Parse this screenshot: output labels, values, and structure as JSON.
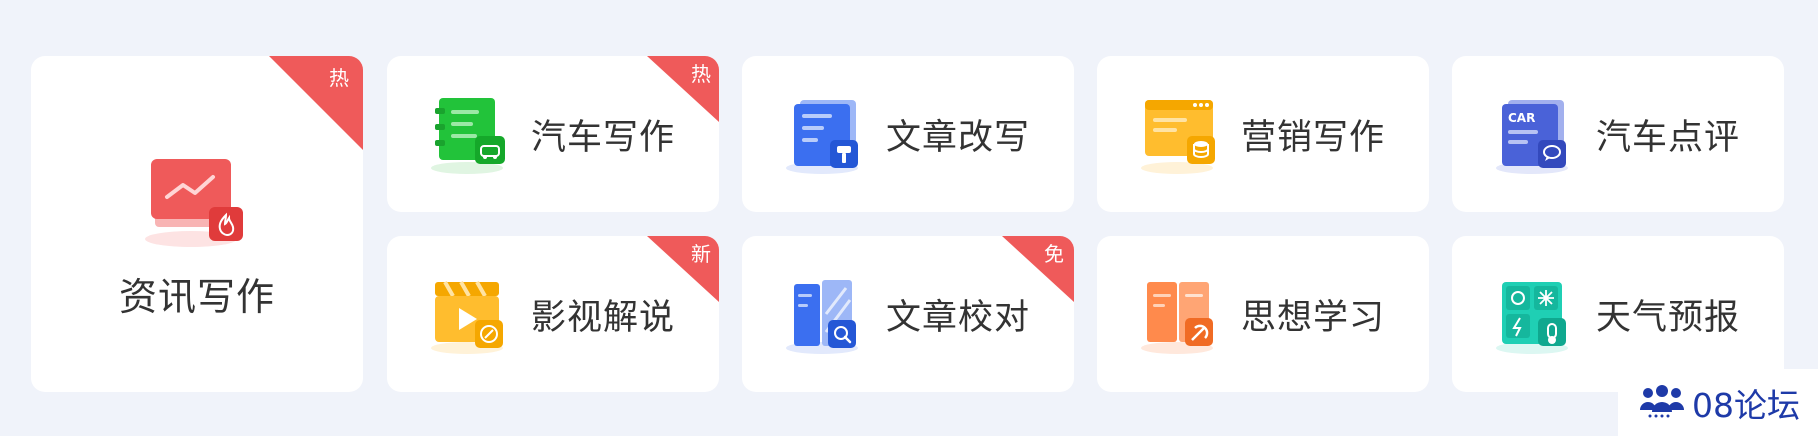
{
  "cards": [
    {
      "label": "资讯写作",
      "badge": "热",
      "icon": "monitor-trend-icon"
    },
    {
      "label": "汽车写作",
      "badge": "热",
      "icon": "car-notebook-icon"
    },
    {
      "label": "文章改写",
      "badge": "",
      "icon": "document-brush-icon"
    },
    {
      "label": "营销写作",
      "badge": "",
      "icon": "browser-database-icon"
    },
    {
      "label": "汽车点评",
      "badge": "",
      "icon": "car-comment-icon",
      "icon_text": "CAR"
    },
    {
      "label": "影视解说",
      "badge": "新",
      "icon": "clapperboard-play-icon"
    },
    {
      "label": "文章校对",
      "badge": "免",
      "icon": "document-search-icon"
    },
    {
      "label": "思想学习",
      "badge": "",
      "icon": "book-party-icon"
    },
    {
      "label": "天气预报",
      "badge": "",
      "icon": "weather-grid-icon"
    }
  ],
  "watermark": {
    "text": "08论坛",
    "icon": "people-group-icon"
  },
  "colors": {
    "background": "#f0f3fa",
    "badge": "#ef5a5a",
    "text": "#333333",
    "green": "#22c33a",
    "blue": "#3b6ff0",
    "yellow": "#ffbd2e",
    "indigo": "#4a62d8",
    "orange": "#ff8a4c",
    "teal": "#1fcfb4",
    "red": "#ef5a5a",
    "watermark": "#1e3aa8"
  }
}
